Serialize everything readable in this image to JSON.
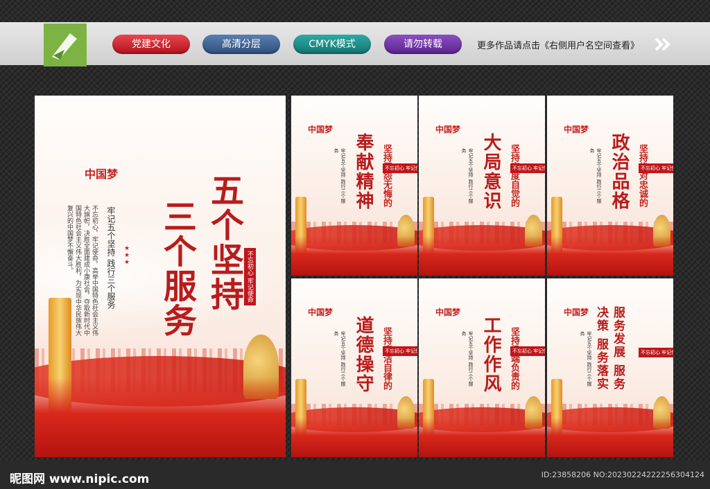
{
  "header": {
    "pills": [
      "党建文化",
      "高清分层",
      "CMYK模式",
      "请勿转载"
    ],
    "tagline": "更多作品请点击《右侧用户名空间查看》"
  },
  "main_poster": {
    "title_line1": "五个坚持",
    "title_line2": "三个服务",
    "subtitle": "牢记五个坚持 践行三个服务",
    "body": "不忘初心，牢记使命，高举中国特色社会主义伟大旗帜，决胜全面建成小康社会，夺取新时代中国特色社会主义伟大胜利，为实现中华民族伟大复兴的中国梦不懈奋斗。",
    "seal": "不忘初心 牢记使命",
    "logo": "中国梦"
  },
  "small_posters": [
    {
      "title": "奉献精神",
      "subtitle": "坚持无怨无悔的"
    },
    {
      "title": "大局意识",
      "subtitle": "坚持高度自觉的"
    },
    {
      "title": "政治品格",
      "subtitle": "坚持绝对忠诚的"
    },
    {
      "title": "道德操守",
      "subtitle": "坚持廉洁自律的"
    },
    {
      "title": "工作作风",
      "subtitle": "坚持极端负责的"
    },
    {
      "title": "服务发展 服务决策 服务落实",
      "subtitle": ""
    }
  ],
  "small_common": {
    "tag": "牢记五个坚持 践行三个服务",
    "seal": "不忘初心 牢记使命",
    "logo": "中国梦"
  },
  "watermark": {
    "left": "昵图网 www.nipic.com",
    "right": "ID:23858206 NO:20230224222256304124"
  }
}
